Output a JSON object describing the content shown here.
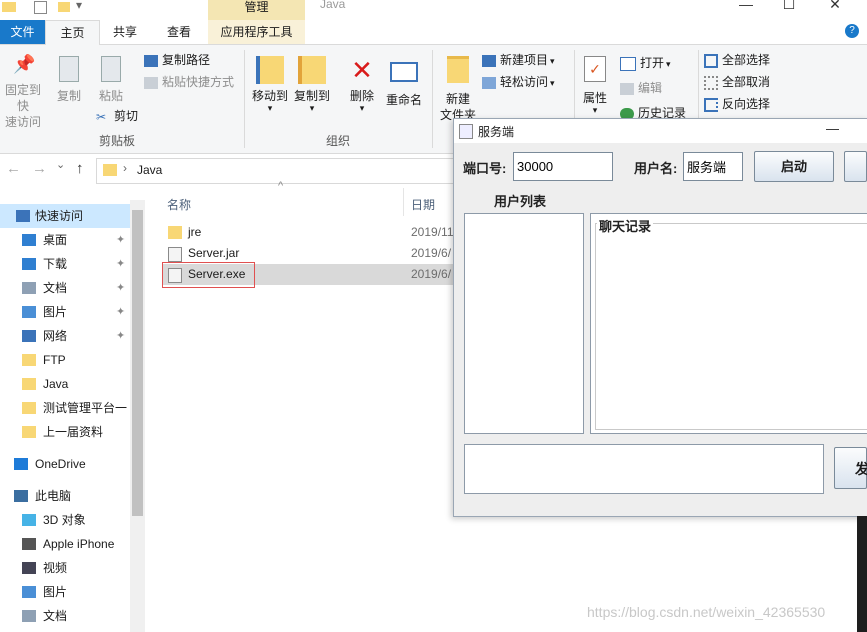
{
  "window": {
    "title": "Java",
    "manage_label": "管理",
    "minimize_glyph": "—",
    "maximize_glyph": "☐",
    "close_glyph": "✕"
  },
  "ribbon_tabs": {
    "file": "文件",
    "home": "主页",
    "share": "共享",
    "view": "查看",
    "app_tools": "应用程序工具",
    "help_glyph": "?"
  },
  "ribbon": {
    "clipboard": {
      "pin_label_1": "固定到快",
      "pin_label_2": "速访问",
      "copy": "复制",
      "paste": "粘贴",
      "copy_path": "复制路径",
      "paste_shortcut": "粘贴快捷方式",
      "cut": "剪切",
      "group_label": "剪贴板"
    },
    "organize": {
      "move_to": "移动到",
      "copy_to": "复制到",
      "delete": "删除",
      "rename": "重命名",
      "group_label": "组织"
    },
    "new": {
      "new_folder_1": "新建",
      "new_folder_2": "文件夹",
      "new_item": "新建项目",
      "easy_access": "轻松访问"
    },
    "open": {
      "properties": "属性",
      "open": "打开",
      "edit": "编辑",
      "history": "历史记录"
    },
    "select": {
      "select_all": "全部选择",
      "select_none": "全部取消",
      "invert": "反向选择"
    }
  },
  "nav": {
    "back_glyph": "←",
    "forward_glyph": "→",
    "down_glyph": "⌄",
    "up_glyph": "↑",
    "path_sep": "›",
    "path": "Java"
  },
  "sidebar": {
    "items": [
      {
        "label": "快速访问",
        "icon": "star-icon"
      },
      {
        "label": "桌面",
        "icon": "desktop-icon",
        "pinned": true
      },
      {
        "label": "下载",
        "icon": "download-icon",
        "pinned": true
      },
      {
        "label": "文档",
        "icon": "document-icon",
        "pinned": true
      },
      {
        "label": "图片",
        "icon": "picture-icon",
        "pinned": true
      },
      {
        "label": "网络",
        "icon": "network-icon",
        "pinned": true
      },
      {
        "label": "FTP",
        "icon": "folder-icon"
      },
      {
        "label": "Java",
        "icon": "folder-icon"
      },
      {
        "label": "测试管理平台一",
        "icon": "folder-icon"
      },
      {
        "label": "上一届资料",
        "icon": "folder-icon"
      },
      {
        "label": "OneDrive",
        "icon": "cloud-icon"
      },
      {
        "label": "此电脑",
        "icon": "computer-icon"
      },
      {
        "label": "3D 对象",
        "icon": "cube-icon"
      },
      {
        "label": "Apple iPhone",
        "icon": "phone-icon"
      },
      {
        "label": "视频",
        "icon": "video-icon"
      },
      {
        "label": "图片",
        "icon": "picture-icon"
      },
      {
        "label": "文档",
        "icon": "document-icon"
      }
    ],
    "pin_glyph": "📌"
  },
  "file_list": {
    "headers": {
      "name": "名称",
      "date": "日期"
    },
    "sort_glyph": "^",
    "rows": [
      {
        "name": "jre",
        "date": "2019/11",
        "icon": "folder-icon"
      },
      {
        "name": "Server.jar",
        "date": "2019/6/",
        "icon": "jar-icon"
      },
      {
        "name": "Server.exe",
        "date": "2019/6/",
        "icon": "exe-icon",
        "selected": true
      }
    ]
  },
  "java_app": {
    "title": "服务端",
    "minimize_glyph": "—",
    "port_label": "端口号:",
    "port_value": "30000",
    "username_label": "用户名:",
    "username_value": "服务端",
    "start_button": "启动",
    "user_list_title": "用户列表",
    "chat_log_title": "聊天记录",
    "send_button": "发"
  },
  "watermark": "https://blog.csdn.net/weixin_42365530"
}
